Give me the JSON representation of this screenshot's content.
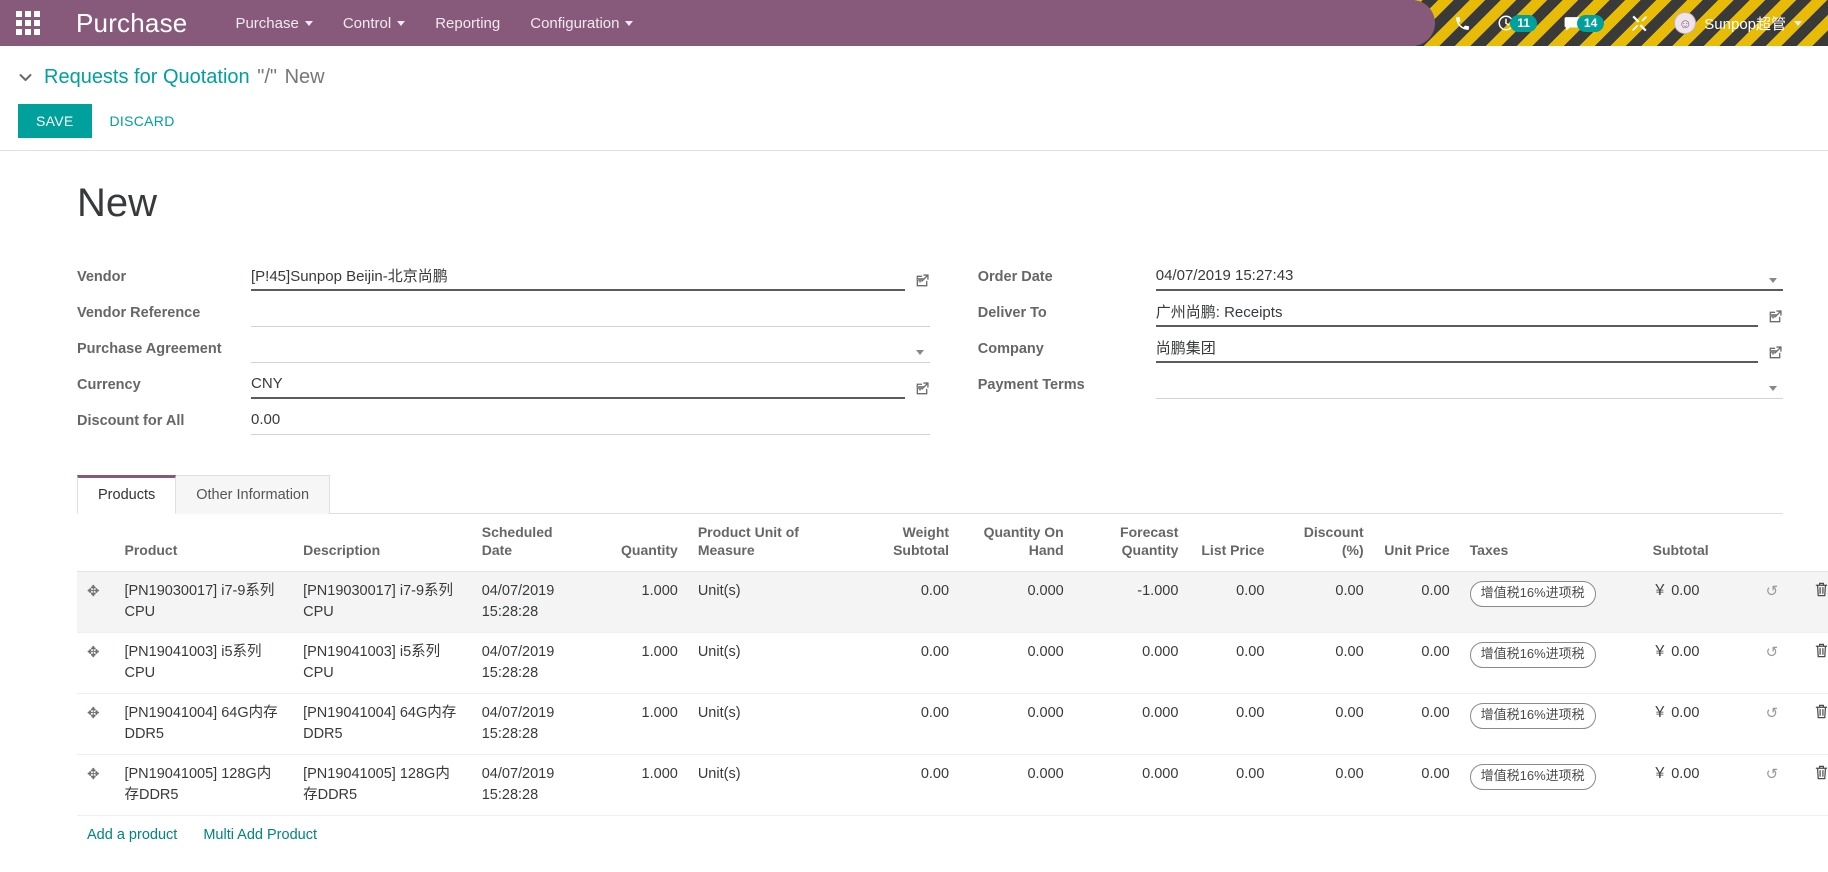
{
  "navbar": {
    "apps_icon": "apps-grid-icon",
    "brand": "Purchase",
    "menus": [
      {
        "label": "Purchase",
        "has_caret": true
      },
      {
        "label": "Control",
        "has_caret": true
      },
      {
        "label": "Reporting",
        "has_caret": false
      },
      {
        "label": "Configuration",
        "has_caret": true
      }
    ],
    "systray": {
      "phone_icon": "phone-icon",
      "activity_icon": "clock-icon",
      "activity_count": "11",
      "messages_icon": "chat-bubble-icon",
      "messages_count": "14",
      "debug_icon": "tools-icon",
      "user_name": "Sunpop超管",
      "avatar_glyph": "☺"
    }
  },
  "breadcrumb": {
    "toggle_icon": "chevron-down-icon",
    "parent": "Requests for Quotation",
    "separator": "\"/\"",
    "current": "New"
  },
  "actions": {
    "save_label": "SAVE",
    "discard_label": "DISCARD"
  },
  "record": {
    "title": "New"
  },
  "form": {
    "left": [
      {
        "label": "Vendor",
        "value": "[P!45]Sunpop Beijin-北京尚鹏",
        "dropdown": true,
        "external": true,
        "filled": true
      },
      {
        "label": "Vendor Reference",
        "value": "",
        "dropdown": false,
        "external": false,
        "filled": false
      },
      {
        "label": "Purchase Agreement",
        "value": "",
        "dropdown": true,
        "external": false,
        "filled": false
      },
      {
        "label": "Currency",
        "value": "CNY",
        "dropdown": true,
        "external": true,
        "filled": true
      },
      {
        "label": "Discount for All",
        "value": "0.00",
        "dropdown": false,
        "external": false,
        "filled": false
      }
    ],
    "right": [
      {
        "label": "Order Date",
        "value": "04/07/2019 15:27:43",
        "dropdown": true,
        "external": false,
        "filled": true
      },
      {
        "label": "Deliver To",
        "value": "广州尚鹏: Receipts",
        "dropdown": true,
        "external": true,
        "filled": true
      },
      {
        "label": "Company",
        "value": "尚鹏集团",
        "dropdown": true,
        "external": true,
        "filled": true
      },
      {
        "label": "Payment Terms",
        "value": "",
        "dropdown": true,
        "external": false,
        "filled": false
      }
    ]
  },
  "notebook": {
    "tabs": [
      {
        "label": "Products",
        "active": true
      },
      {
        "label": "Other Information",
        "active": false
      }
    ]
  },
  "lines_table": {
    "columns": [
      "Product",
      "Description",
      "Scheduled Date",
      "Quantity",
      "Product Unit of Measure",
      "Weight Subtotal",
      "Quantity On Hand",
      "Forecast Quantity",
      "List Price",
      "Discount (%)",
      "Unit Price",
      "Taxes",
      "Subtotal"
    ],
    "rows": [
      {
        "handle_icon": "drag-handle-icon",
        "product": "[PN19030017] i7-9系列CPU",
        "description": "[PN19030017] i7-9系列CPU",
        "scheduled_date": "04/07/2019 15:28:28",
        "quantity": "1.000",
        "uom": "Unit(s)",
        "weight_subtotal": "0.00",
        "qty_on_hand": "0.000",
        "forecast_quantity": "-1.000",
        "list_price": "0.00",
        "discount": "0.00",
        "unit_price": "0.00",
        "taxes": "增值税16%进项税",
        "subtotal": "￥ 0.00",
        "history_icon": "history-icon",
        "delete_icon": "trash-icon"
      },
      {
        "handle_icon": "drag-handle-icon",
        "product": "[PN19041003] i5系列CPU",
        "description": "[PN19041003] i5系列CPU",
        "scheduled_date": "04/07/2019 15:28:28",
        "quantity": "1.000",
        "uom": "Unit(s)",
        "weight_subtotal": "0.00",
        "qty_on_hand": "0.000",
        "forecast_quantity": "0.000",
        "list_price": "0.00",
        "discount": "0.00",
        "unit_price": "0.00",
        "taxes": "增值税16%进项税",
        "subtotal": "￥ 0.00",
        "history_icon": "history-icon",
        "delete_icon": "trash-icon"
      },
      {
        "handle_icon": "drag-handle-icon",
        "product": "[PN19041004] 64G内存DDR5",
        "description": "[PN19041004] 64G内存DDR5",
        "scheduled_date": "04/07/2019 15:28:28",
        "quantity": "1.000",
        "uom": "Unit(s)",
        "weight_subtotal": "0.00",
        "qty_on_hand": "0.000",
        "forecast_quantity": "0.000",
        "list_price": "0.00",
        "discount": "0.00",
        "unit_price": "0.00",
        "taxes": "增值税16%进项税",
        "subtotal": "￥ 0.00",
        "history_icon": "history-icon",
        "delete_icon": "trash-icon"
      },
      {
        "handle_icon": "drag-handle-icon",
        "product": "[PN19041005] 128G内存DDR5",
        "description": "[PN19041005] 128G内存DDR5",
        "scheduled_date": "04/07/2019 15:28:28",
        "quantity": "1.000",
        "uom": "Unit(s)",
        "weight_subtotal": "0.00",
        "qty_on_hand": "0.000",
        "forecast_quantity": "0.000",
        "list_price": "0.00",
        "discount": "0.00",
        "unit_price": "0.00",
        "taxes": "增值税16%进项税",
        "subtotal": "￥ 0.00",
        "history_icon": "history-icon",
        "delete_icon": "trash-icon"
      }
    ],
    "add_links": [
      "Add a product",
      "Multi Add Product"
    ]
  },
  "colors": {
    "brand_purple": "#875A7B",
    "accent_teal": "#00A09D",
    "badge_teal": "#00A09D",
    "hazard_yellow": "#e8bc06",
    "hazard_dark": "#3a3a3a"
  }
}
